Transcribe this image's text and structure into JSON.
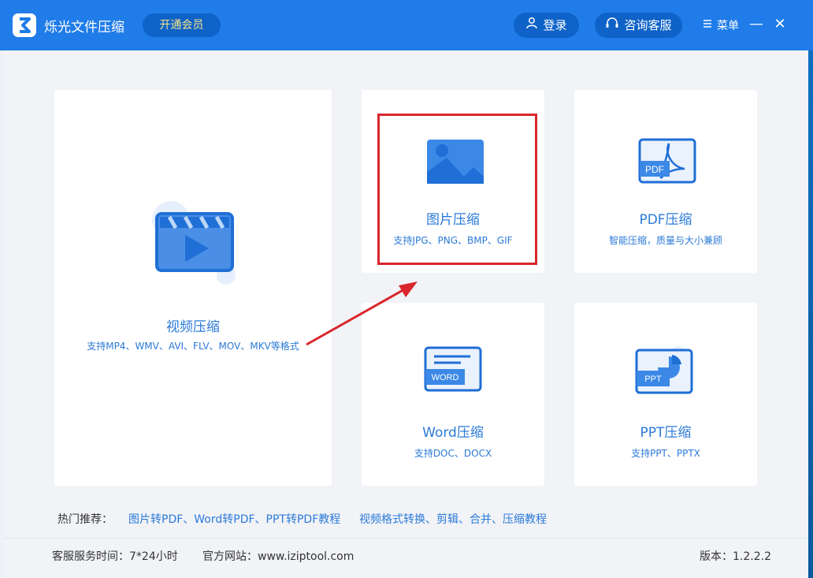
{
  "app": {
    "title": "烁光文件压缩",
    "vip_label": "开通会员"
  },
  "header": {
    "login_label": "登录",
    "service_label": "咨询客服",
    "menu_label": "菜单",
    "minimize": "—",
    "close": "✕"
  },
  "cards": {
    "video": {
      "title": "视频压缩",
      "subtitle": "支持MP4、WMV、AVI、FLV、MOV、MKV等格式"
    },
    "image": {
      "title": "图片压缩",
      "subtitle": "支持JPG、PNG、BMP、GIF"
    },
    "pdf": {
      "title": "PDF压缩",
      "subtitle": "智能压缩，质量与大小兼顾",
      "icon_text": "PDF"
    },
    "word": {
      "title": "Word压缩",
      "subtitle": "支持DOC、DOCX",
      "icon_text": "WORD"
    },
    "ppt": {
      "title": "PPT压缩",
      "subtitle": "支持PPT、PPTX",
      "icon_text": "PPT"
    }
  },
  "hot": {
    "label": "热门推荐：",
    "link1": "图片转PDF、Word转PDF、PPT转PDF教程",
    "link2": "视频格式转换、剪辑、合并、压缩教程"
  },
  "footer": {
    "service_time": "客服服务时间：7*24小时",
    "website": "官方网站：www.iziptool.com",
    "version": "版本：1.2.2.2"
  },
  "colors": {
    "brand": "#1f7ce8",
    "accent_text": "#2b7ad8",
    "highlight": "#d9262c"
  }
}
